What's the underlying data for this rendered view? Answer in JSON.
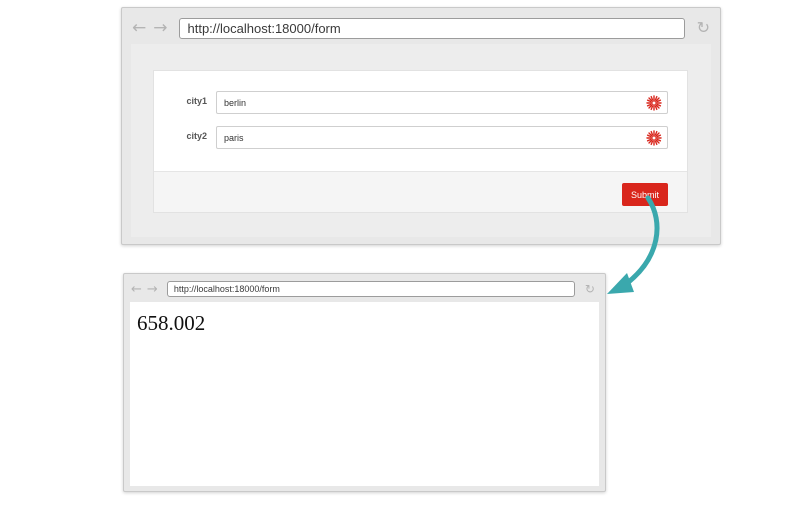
{
  "top_window": {
    "url": "http://localhost:18000/form",
    "form": {
      "fields": [
        {
          "label": "city1",
          "value": "berlin"
        },
        {
          "label": "city2",
          "value": "paris"
        }
      ],
      "submit_label": "Submit"
    }
  },
  "bottom_window": {
    "url": "http://localhost:18000/form",
    "result": "658.002"
  },
  "icons": {
    "back": "arrow-left-icon",
    "forward": "arrow-right-icon",
    "reload": "reload-icon",
    "field_spinner": "spinner-icon",
    "connector": "curved-arrow-icon"
  },
  "colors": {
    "submit": "#d9261c",
    "spinner": "#d9261c",
    "connector": "#3aa8ad"
  }
}
